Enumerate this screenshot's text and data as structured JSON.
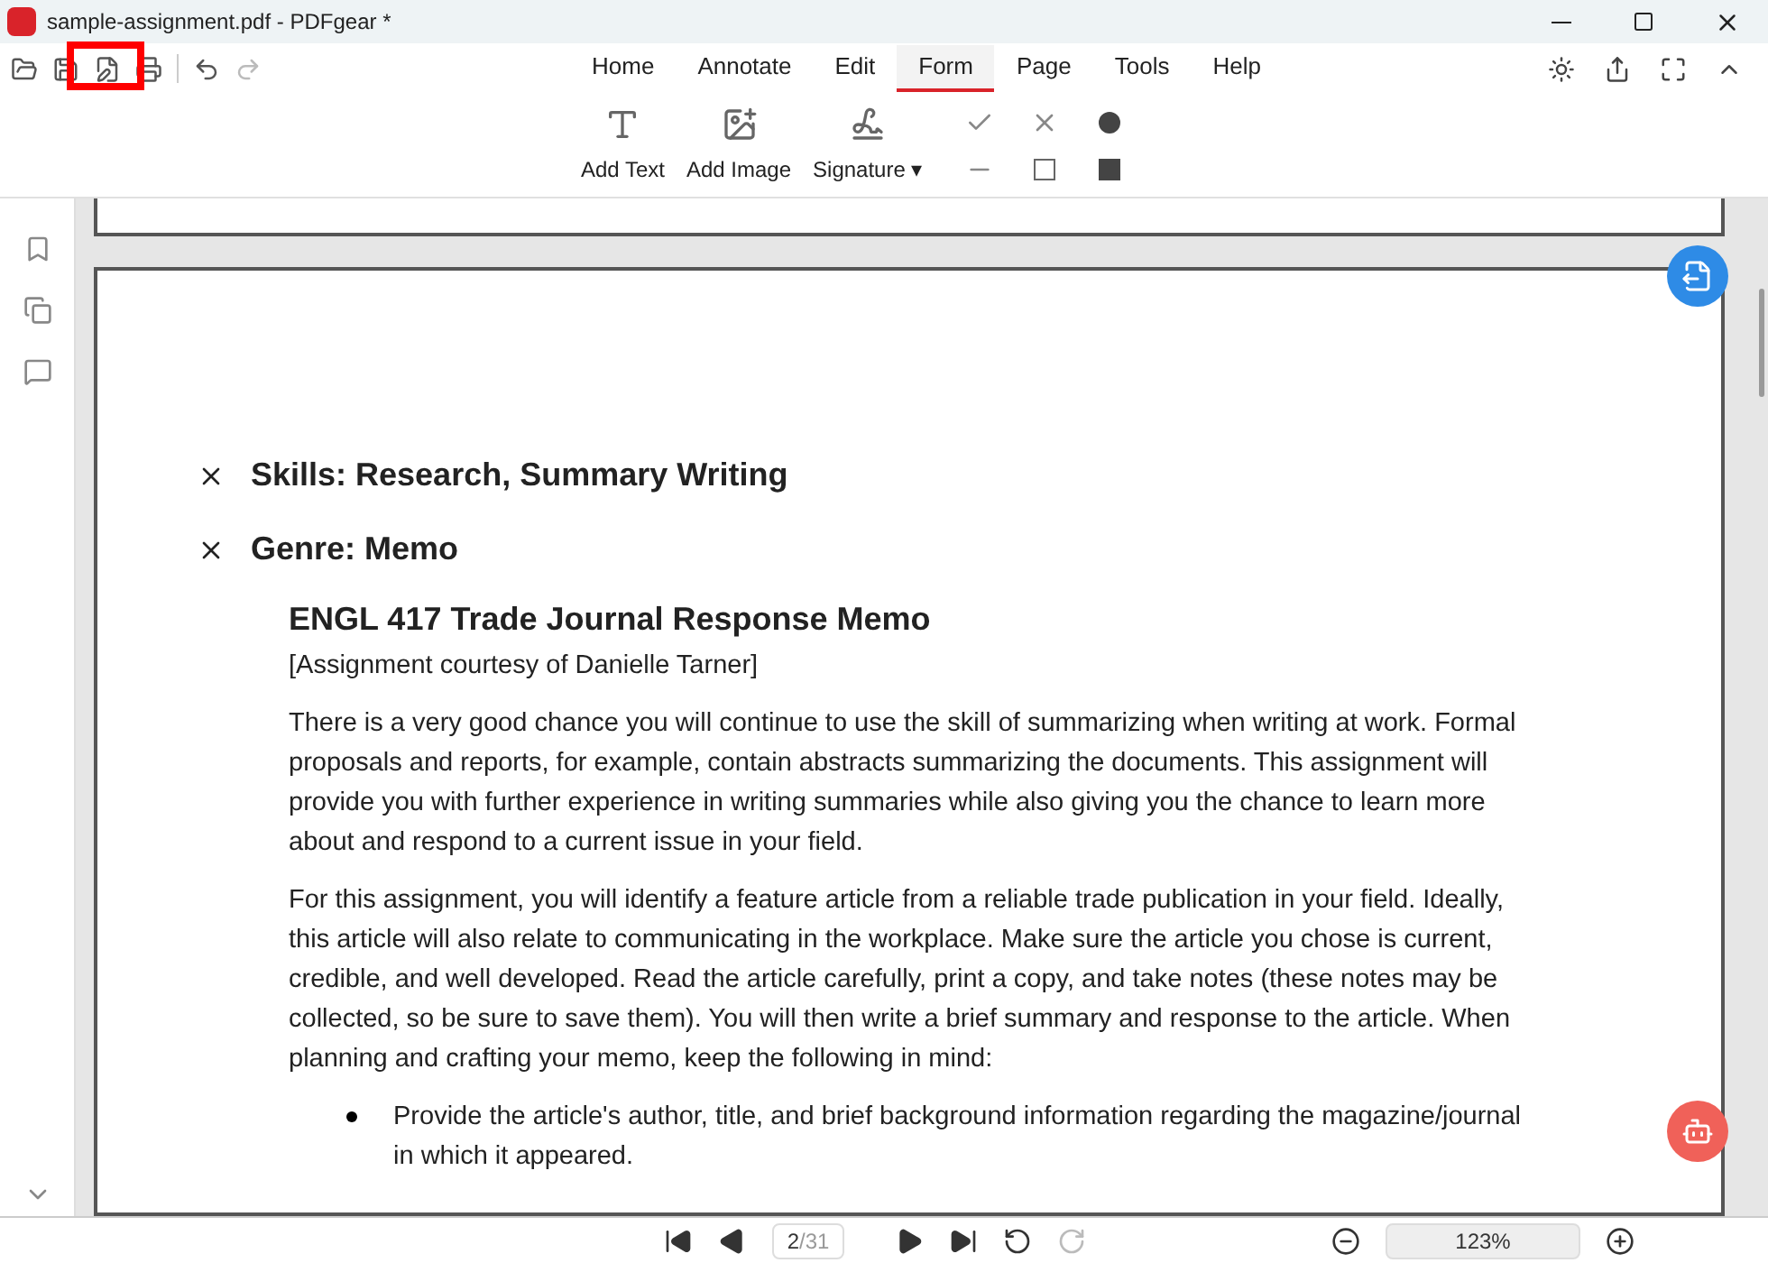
{
  "window": {
    "title": "sample-assignment.pdf - PDFgear *"
  },
  "menu_tabs": [
    {
      "label": "Home",
      "selected": false
    },
    {
      "label": "Annotate",
      "selected": false
    },
    {
      "label": "Edit",
      "selected": false
    },
    {
      "label": "Form",
      "selected": true
    },
    {
      "label": "Page",
      "selected": false
    },
    {
      "label": "Tools",
      "selected": false
    },
    {
      "label": "Help",
      "selected": false
    }
  ],
  "ribbon": [
    {
      "kind": "text",
      "label": "Add Text"
    },
    {
      "kind": "image",
      "label": "Add Image"
    },
    {
      "kind": "signature",
      "label": "Signature ▾"
    }
  ],
  "document": {
    "headings": [
      {
        "text": "Skills: Research, Summary Writing",
        "checked": true
      },
      {
        "text": "Genre: Memo",
        "checked": true
      }
    ],
    "title": "ENGL 417 Trade Journal Response Memo",
    "credit": "[Assignment courtesy of Danielle Tarner]",
    "paragraphs": [
      "There is a very good chance you will continue to use the skill of summarizing when writing at work. Formal proposals and reports, for example, contain abstracts summarizing the documents.  This assignment will provide you with further experience in writing summaries while also giving you the chance to learn more about and respond to a current issue in your field.",
      "For this assignment, you will identify a feature article from a reliable trade publication in your field. Ideally, this article will also relate to communicating in the workplace. Make sure the article you chose is current, credible, and well developed. Read the article carefully, print a copy, and take notes (these notes may be collected, so be sure to save them).  You will then write a brief summary and response to the article. When planning and crafting your memo, keep the following in mind:"
    ],
    "bullets": [
      "Provide the article's author, title, and brief background information regarding the magazine/journal in which it appeared."
    ]
  },
  "pager": {
    "page": "2",
    "total": "/31",
    "zoom": "123%"
  }
}
